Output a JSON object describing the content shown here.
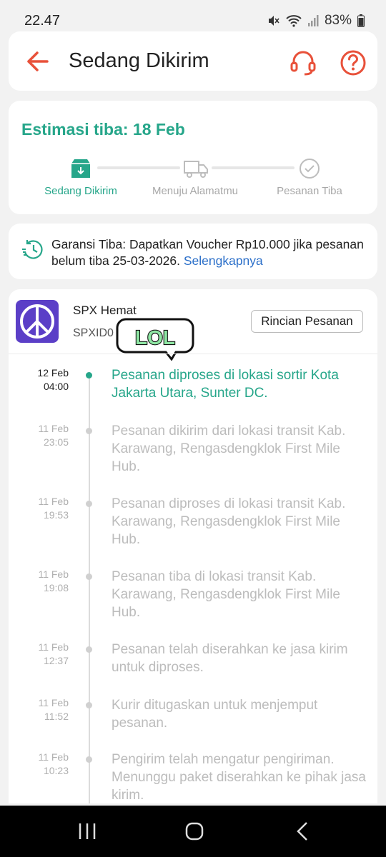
{
  "status_bar": {
    "time": "22.47",
    "battery": "83%"
  },
  "header": {
    "title": "Sedang Dikirim"
  },
  "estimate": {
    "title": "Estimasi tiba: 18 Feb",
    "steps": [
      {
        "label": "Sedang Dikirim",
        "active": true
      },
      {
        "label": "Menuju Alamatmu",
        "active": false
      },
      {
        "label": "Pesanan Tiba",
        "active": false
      }
    ]
  },
  "guarantee": {
    "text": "Garansi Tiba: Dapatkan Voucher Rp10.000 jika pesanan belum tiba 25-03-2026. ",
    "link": "Selengkapnya"
  },
  "shipment": {
    "courier": "SPX Hemat",
    "tracking_prefix": "SPXID0",
    "tracking_suffix": "2",
    "sticker_text": "LOL",
    "detail_button": "Rincian Pesanan"
  },
  "events": [
    {
      "date": "12 Feb",
      "time": "04:00",
      "text": "Pesanan diproses di lokasi sortir Kota Jakarta Utara, Sunter DC.",
      "active": true
    },
    {
      "date": "11 Feb",
      "time": "23:05",
      "text": "Pesanan dikirim dari lokasi transit Kab. Karawang, Rengasdengklok First Mile Hub.",
      "active": false
    },
    {
      "date": "11 Feb",
      "time": "19:53",
      "text": "Pesanan diproses di lokasi transit Kab. Karawang, Rengasdengklok First Mile Hub.",
      "active": false
    },
    {
      "date": "11 Feb",
      "time": "19:08",
      "text": "Pesanan tiba di lokasi transit Kab. Karawang, Rengasdengklok First Mile Hub.",
      "active": false
    },
    {
      "date": "11 Feb",
      "time": "12:37",
      "text": "Pesanan telah diserahkan ke jasa kirim untuk diproses.",
      "active": false
    },
    {
      "date": "11 Feb",
      "time": "11:52",
      "text": "Kurir ditugaskan untuk menjemput pesanan.",
      "active": false
    },
    {
      "date": "11 Feb",
      "time": "10:23",
      "text": "Pengirim telah mengatur pengiriman. Menunggu paket diserahkan ke pihak jasa kirim.",
      "active": false
    }
  ],
  "colors": {
    "accent": "#26a68a",
    "header_icons": "#e8513a",
    "link": "#2b6fc9",
    "logo_bg": "#5b3fc7"
  },
  "icons": [
    "mute-icon",
    "wifi-icon",
    "signal-icon",
    "battery-icon",
    "back-arrow-icon",
    "headset-icon",
    "help-icon",
    "box-icon",
    "truck-icon",
    "check-circle-icon",
    "clock-refresh-icon",
    "peace-logo-icon",
    "copy-icon",
    "recents-icon",
    "home-icon",
    "back-nav-icon"
  ]
}
